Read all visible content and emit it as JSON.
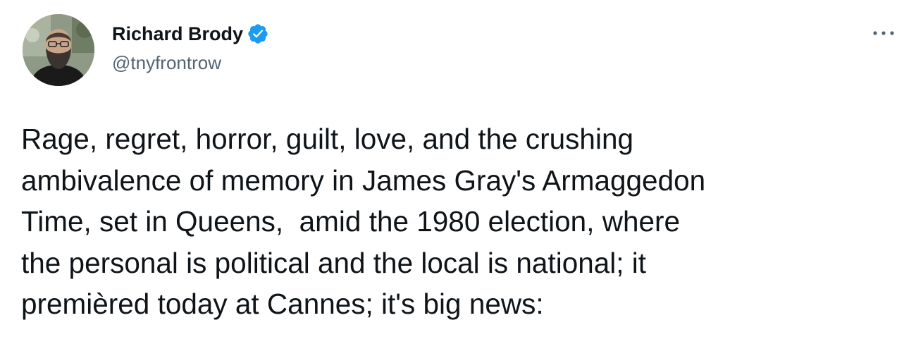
{
  "author": {
    "display_name": "Richard Brody",
    "handle": "@tnyfrontrow",
    "verified": true,
    "verified_color": "#1d9bf0",
    "avatar_icon": "profile-photo"
  },
  "menu": {
    "icon": "more-horizontal-icon"
  },
  "tweet": {
    "text": "Rage, regret, horror, guilt, love, and the crushing\nambivalence of memory in James Gray's Armaggedon\nTime, set in Queens,  amid the 1980 election, where\nthe personal is political and the local is national; it\npremièred today at Cannes; it's big news:"
  },
  "colors": {
    "text": "#0f1419",
    "secondary_text": "#536471",
    "background": "#ffffff"
  }
}
